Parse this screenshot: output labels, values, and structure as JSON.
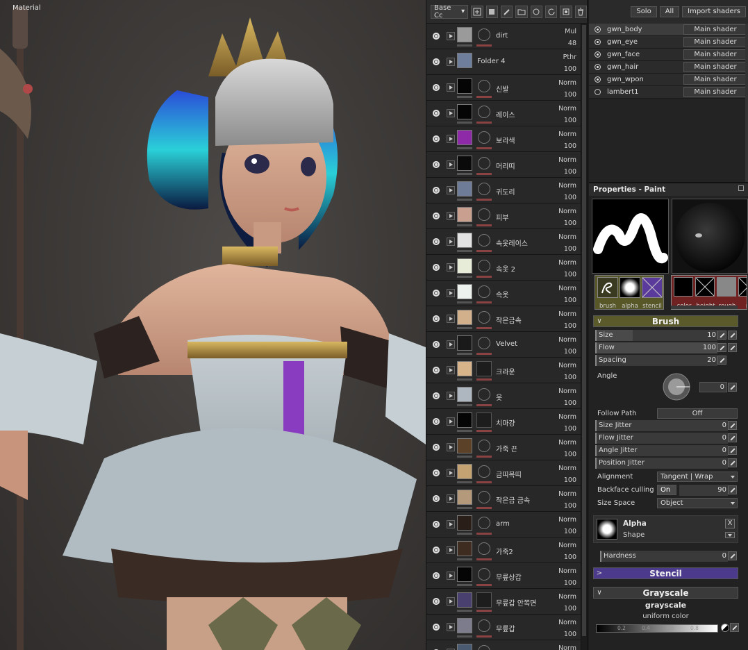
{
  "viewport": {
    "label": "Material"
  },
  "layers": {
    "toolbar": {
      "select_label": "Base Cc"
    },
    "items": [
      {
        "name": "dirt",
        "blend": "Mul",
        "opacity": "48",
        "folder": false,
        "thumb": "#9a9a9a",
        "ring": true
      },
      {
        "name": "Folder 4",
        "blend": "Pthr",
        "opacity": "100",
        "folder": true,
        "thumb": "#6f7e9a",
        "ring": false
      },
      {
        "name": "신발",
        "blend": "Norm",
        "opacity": "100",
        "folder": false,
        "thumb": "#050505",
        "ring": true
      },
      {
        "name": "레이스",
        "blend": "Norm",
        "opacity": "100",
        "folder": false,
        "thumb": "#050505",
        "ring": true
      },
      {
        "name": "보라색",
        "blend": "Norm",
        "opacity": "100",
        "folder": false,
        "thumb": "#8e2aa8",
        "ring": true
      },
      {
        "name": "머리띠",
        "blend": "Norm",
        "opacity": "100",
        "folder": false,
        "thumb": "#0a0a0a",
        "ring": true
      },
      {
        "name": "귀도리",
        "blend": "Norm",
        "opacity": "100",
        "folder": false,
        "thumb": "#6e7c98",
        "ring": true
      },
      {
        "name": "피부",
        "blend": "Norm",
        "opacity": "100",
        "folder": false,
        "thumb": "#c9a08f",
        "ring": true
      },
      {
        "name": "속옷레이스",
        "blend": "Norm",
        "opacity": "100",
        "folder": false,
        "thumb": "#e2e2e2",
        "ring": true
      },
      {
        "name": "속옷 2",
        "blend": "Norm",
        "opacity": "100",
        "folder": false,
        "thumb": "#e7ecd8",
        "ring": true
      },
      {
        "name": "속옷",
        "blend": "Norm",
        "opacity": "100",
        "folder": false,
        "thumb": "#eef2ee",
        "ring": true
      },
      {
        "name": "작은금속",
        "blend": "Norm",
        "opacity": "100",
        "folder": false,
        "thumb": "#d2b08c",
        "ring": true
      },
      {
        "name": "Velvet",
        "blend": "Norm",
        "opacity": "100",
        "folder": false,
        "thumb": "#1a1a1a",
        "ring": true
      },
      {
        "name": "크라운",
        "blend": "Norm",
        "opacity": "100",
        "folder": false,
        "thumb": "#d8b48a",
        "ring": false
      },
      {
        "name": "옷",
        "blend": "Norm",
        "opacity": "100",
        "folder": false,
        "thumb": "#aeb6bf",
        "ring": true
      },
      {
        "name": "치마걍",
        "blend": "Norm",
        "opacity": "100",
        "folder": false,
        "thumb": "#050505",
        "ring": false
      },
      {
        "name": "가죽 끈",
        "blend": "Norm",
        "opacity": "100",
        "folder": false,
        "thumb": "#5a4128",
        "ring": true
      },
      {
        "name": "금띠목띠",
        "blend": "Norm",
        "opacity": "100",
        "folder": false,
        "thumb": "#c4a272",
        "ring": true
      },
      {
        "name": "작은금 금속",
        "blend": "Norm",
        "opacity": "100",
        "folder": false,
        "thumb": "#b49a7a",
        "ring": true
      },
      {
        "name": "arm",
        "blend": "Norm",
        "opacity": "100",
        "folder": false,
        "thumb": "#2a1f18",
        "ring": true
      },
      {
        "name": "가죽2",
        "blend": "Norm",
        "opacity": "100",
        "folder": false,
        "thumb": "#3e2c20",
        "ring": true
      },
      {
        "name": "무릎상갑",
        "blend": "Norm",
        "opacity": "100",
        "folder": false,
        "thumb": "#050505",
        "ring": true
      },
      {
        "name": "무릎갑 안쪽면",
        "blend": "Norm",
        "opacity": "100",
        "folder": false,
        "thumb": "#4a4070",
        "ring": false
      },
      {
        "name": "무릎갑",
        "blend": "Norm",
        "opacity": "100",
        "folder": false,
        "thumb": "#7c7c8c",
        "ring": true
      },
      {
        "name": "",
        "blend": "Norm",
        "opacity": "",
        "folder": false,
        "thumb": "#4a5a70",
        "ring": true
      }
    ]
  },
  "shaders": {
    "buttons": {
      "solo": "Solo",
      "all": "All",
      "import": "Import shaders"
    },
    "items": [
      {
        "name": "gwn_body",
        "type": "Main shader",
        "selected": true,
        "checked": true
      },
      {
        "name": "gwn_eye",
        "type": "Main shader",
        "selected": false,
        "checked": true
      },
      {
        "name": "gwn_face",
        "type": "Main shader",
        "selected": false,
        "checked": true
      },
      {
        "name": "gwn_hair",
        "type": "Main shader",
        "selected": false,
        "checked": true
      },
      {
        "name": "gwn_wpon",
        "type": "Main shader",
        "selected": false,
        "checked": true
      },
      {
        "name": "lambert1",
        "type": "Main shader",
        "selected": false,
        "checked": false
      }
    ]
  },
  "properties": {
    "title": "Properties - Paint",
    "slots_a": [
      {
        "label": "brush"
      },
      {
        "label": "alpha"
      },
      {
        "label": "stencil"
      }
    ],
    "slots_b": [
      {
        "label": "color"
      },
      {
        "label": "height"
      },
      {
        "label": "rough"
      },
      {
        "label": "m"
      }
    ],
    "brush_section": "Brush",
    "size": {
      "label": "Size",
      "value": "10",
      "fraction": 0.3
    },
    "flow": {
      "label": "Flow",
      "value": "100",
      "fraction": 1.0
    },
    "spacing": {
      "label": "Spacing",
      "value": "20",
      "fraction": 0.0
    },
    "angle": {
      "label": "Angle",
      "value": "0"
    },
    "follow_path": {
      "label": "Follow Path",
      "value": "Off"
    },
    "size_jitter": {
      "label": "Size Jitter",
      "value": "0"
    },
    "flow_jitter": {
      "label": "Flow Jitter",
      "value": "0"
    },
    "angle_jitter": {
      "label": "Angle Jitter",
      "value": "0"
    },
    "position_jitter": {
      "label": "Position Jitter",
      "value": "0"
    },
    "alignment": {
      "label": "Alignment",
      "value": "Tangent | Wrap"
    },
    "backface": {
      "label": "Backface culling",
      "toggle": "On",
      "value": "90"
    },
    "size_space": {
      "label": "Size Space",
      "value": "Object"
    },
    "alpha": {
      "title": "Alpha",
      "shape": "Shape",
      "close": "X"
    },
    "hardness": {
      "label": "Hardness",
      "value": "0"
    },
    "stencil_section": "Stencil",
    "gray_section": "Grayscale",
    "gray_title": "grayscale",
    "gray_sub": "uniform color",
    "gray_ticks": [
      "0.2",
      "0.4",
      "0.6",
      "0.8"
    ]
  }
}
